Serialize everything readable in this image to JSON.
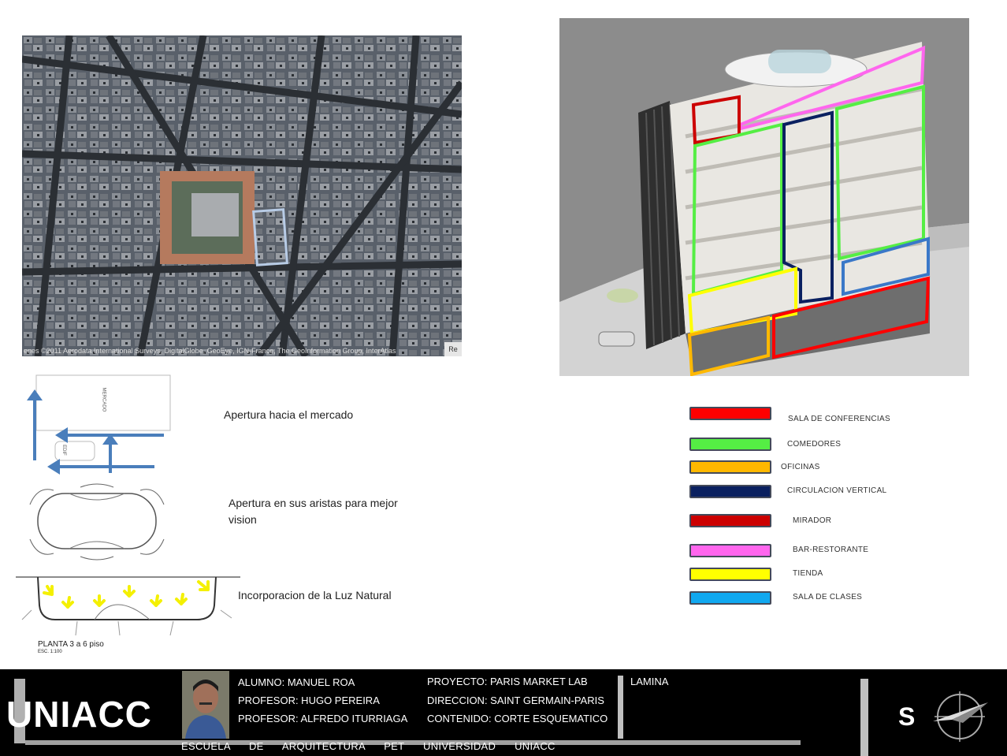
{
  "aerial": {
    "credit": "enes ©2011 Aerodata International Surveys, DigitalGlobe, GeoEye, IGN-France, The GeoInformation Group, InterAtlas",
    "credit_box": "Re"
  },
  "diagrams": {
    "mercado_label": "MERCADO",
    "edif_label": "EDIF",
    "plan_title": "PLANTA 3 a 6 piso",
    "plan_scale": "ESC. 1:100"
  },
  "captions": {
    "apertura_mercado": "Apertura  hacia el mercado",
    "apertura_aristas": "Apertura en sus aristas para mejor vision",
    "luz_natural": "Incorporacion de la Luz Natural"
  },
  "legend": [
    {
      "label": "SALA DE CONFERENCIAS",
      "color": "#ff0000"
    },
    {
      "label": "COMEDORES",
      "color": "#55ee44"
    },
    {
      "label": "OFICINAS",
      "color": "#ffb800"
    },
    {
      "label": "CIRCULACION VERTICAL",
      "color": "#0a2060"
    },
    {
      "label": "MIRADOR",
      "color": "#cc0000"
    },
    {
      "label": "BAR-RESTORANTE",
      "color": "#ff66ee"
    },
    {
      "label": "TIENDA",
      "color": "#ffff00"
    },
    {
      "label": "SALA DE CLASES",
      "color": "#10a8f0"
    }
  ],
  "footer": {
    "brand": "UNIACC",
    "alumno": "ALUMNO: MANUEL ROA",
    "profesor1": "PROFESOR: HUGO PEREIRA",
    "profesor2": "PROFESOR: ALFREDO ITURRIAGA",
    "proyecto": "PROYECTO: PARIS MARKET LAB",
    "direccion": "DIRECCION: SAINT GERMAIN-PARIS",
    "contenido": "CONTENIDO: CORTE ESQUEMATICO",
    "lamina": "LAMINA",
    "sheet_letter": "S",
    "bottom_line": "ESCUELA DE ARQUITECTURA PET UNIVERSIDAD UNIACC"
  }
}
